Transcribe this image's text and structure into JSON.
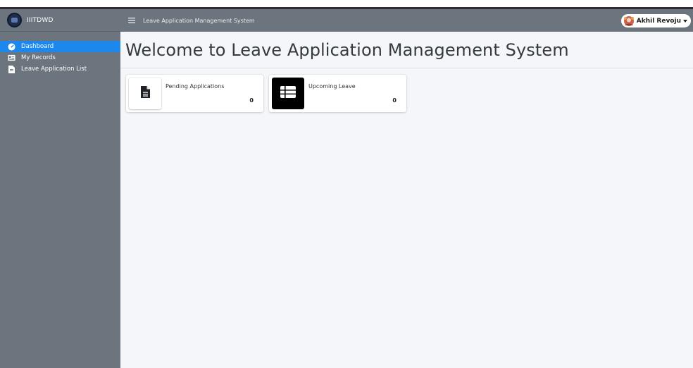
{
  "brand": {
    "name": "IIITDWD"
  },
  "navbar": {
    "title": "Leave Application Management System"
  },
  "user": {
    "name": "Akhil Revoju"
  },
  "sidebar": {
    "items": [
      {
        "label": "Dashboard",
        "icon": "tachometer-icon",
        "active": true
      },
      {
        "label": "My Records",
        "icon": "id-card-icon",
        "active": false
      },
      {
        "label": "Leave Application List",
        "icon": "file-icon",
        "active": false
      }
    ]
  },
  "main": {
    "title": "Welcome to Leave Application Management System",
    "boxes": [
      {
        "label": "Pending Applications",
        "value": "0",
        "icon": "file-icon"
      },
      {
        "label": "Upcoming Leave",
        "value": "0",
        "icon": "table-icon"
      }
    ]
  },
  "colors": {
    "sidebar": "#6c757d",
    "active": "#1c88ee",
    "background": "#f4f6f9"
  }
}
